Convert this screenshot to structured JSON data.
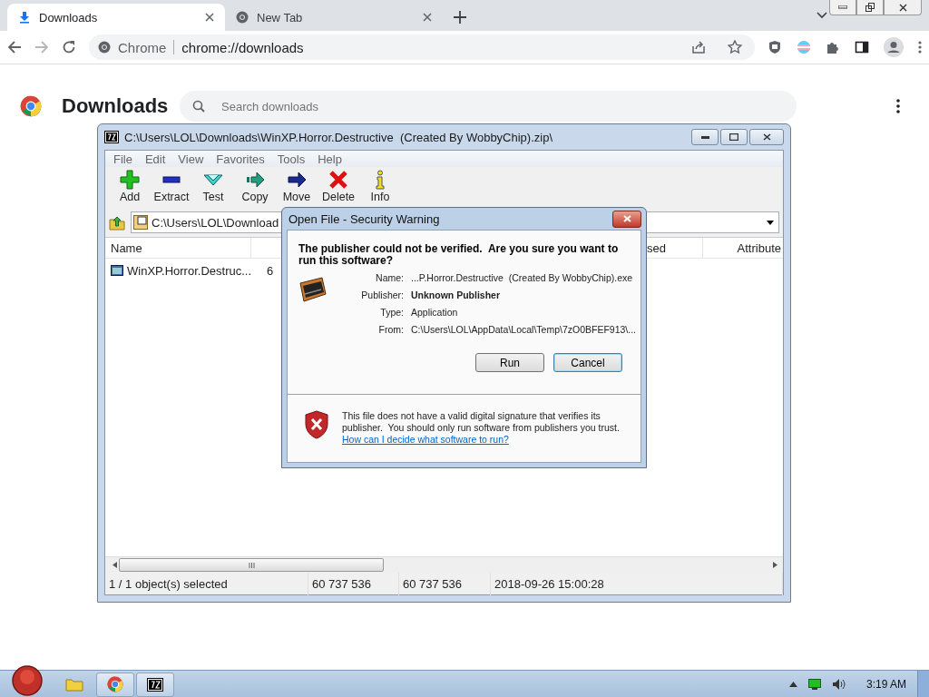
{
  "browser": {
    "tabs": [
      {
        "title": "Downloads",
        "selected": true
      },
      {
        "title": "New Tab",
        "selected": false
      }
    ],
    "address": {
      "site_label": "Chrome",
      "url": "chrome://downloads"
    }
  },
  "page": {
    "title": "Downloads",
    "search": {
      "placeholder": "Search downloads"
    }
  },
  "archive_window": {
    "title": "C:\\Users\\LOL\\Downloads\\WinXP.Horror.Destructive  (Created By WobbyChip).zip\\",
    "menu": [
      "File",
      "Edit",
      "View",
      "Favorites",
      "Tools",
      "Help"
    ],
    "toolbar": [
      {
        "label": "Add",
        "kind": "add"
      },
      {
        "label": "Extract",
        "kind": "extract"
      },
      {
        "label": "Test",
        "kind": "test"
      },
      {
        "label": "Copy",
        "kind": "copy"
      },
      {
        "label": "Move",
        "kind": "move"
      },
      {
        "label": "Delete",
        "kind": "delete"
      },
      {
        "label": "Info",
        "kind": "info"
      }
    ],
    "path": "C:\\Users\\LOL\\Download",
    "columns": [
      "Name",
      "sed",
      "Attribute"
    ],
    "rows": [
      {
        "name": "WinXP.Horror.Destruc...",
        "column_2": "6"
      }
    ],
    "status_bar": [
      "1 / 1 object(s) selected",
      "60 737 536",
      "60 737 536",
      "2018-09-26 15:00:28"
    ]
  },
  "dialog": {
    "title": "Open File - Security Warning",
    "heading": "The publisher could not be verified.  Are you sure you want to run this software?",
    "fields": [
      {
        "label": "Name:",
        "value": "...P.Horror.Destructive  (Created By WobbyChip).exe",
        "kind": "plain"
      },
      {
        "label": "Publisher:",
        "value": "Unknown Publisher",
        "kind": "bold"
      },
      {
        "label": "Type:",
        "value": "Application",
        "kind": "plain"
      },
      {
        "label": "From:",
        "value": "C:\\Users\\LOL\\AppData\\Local\\Temp\\7zO0BFEF913\\...",
        "kind": "plain"
      }
    ],
    "buttons": [
      {
        "label": "Run",
        "selected": false
      },
      {
        "label": "Cancel",
        "selected": true
      }
    ],
    "warning": "This file does not have a valid digital signature that verifies its publisher.  You should only run software from publishers you trust.",
    "link": "How can I decide what software to run?"
  },
  "taskbar": {
    "items": [
      {
        "kind": "folder"
      },
      {
        "kind": "browser"
      },
      {
        "kind": "archiver"
      }
    ],
    "clock": "3:19 AM"
  }
}
